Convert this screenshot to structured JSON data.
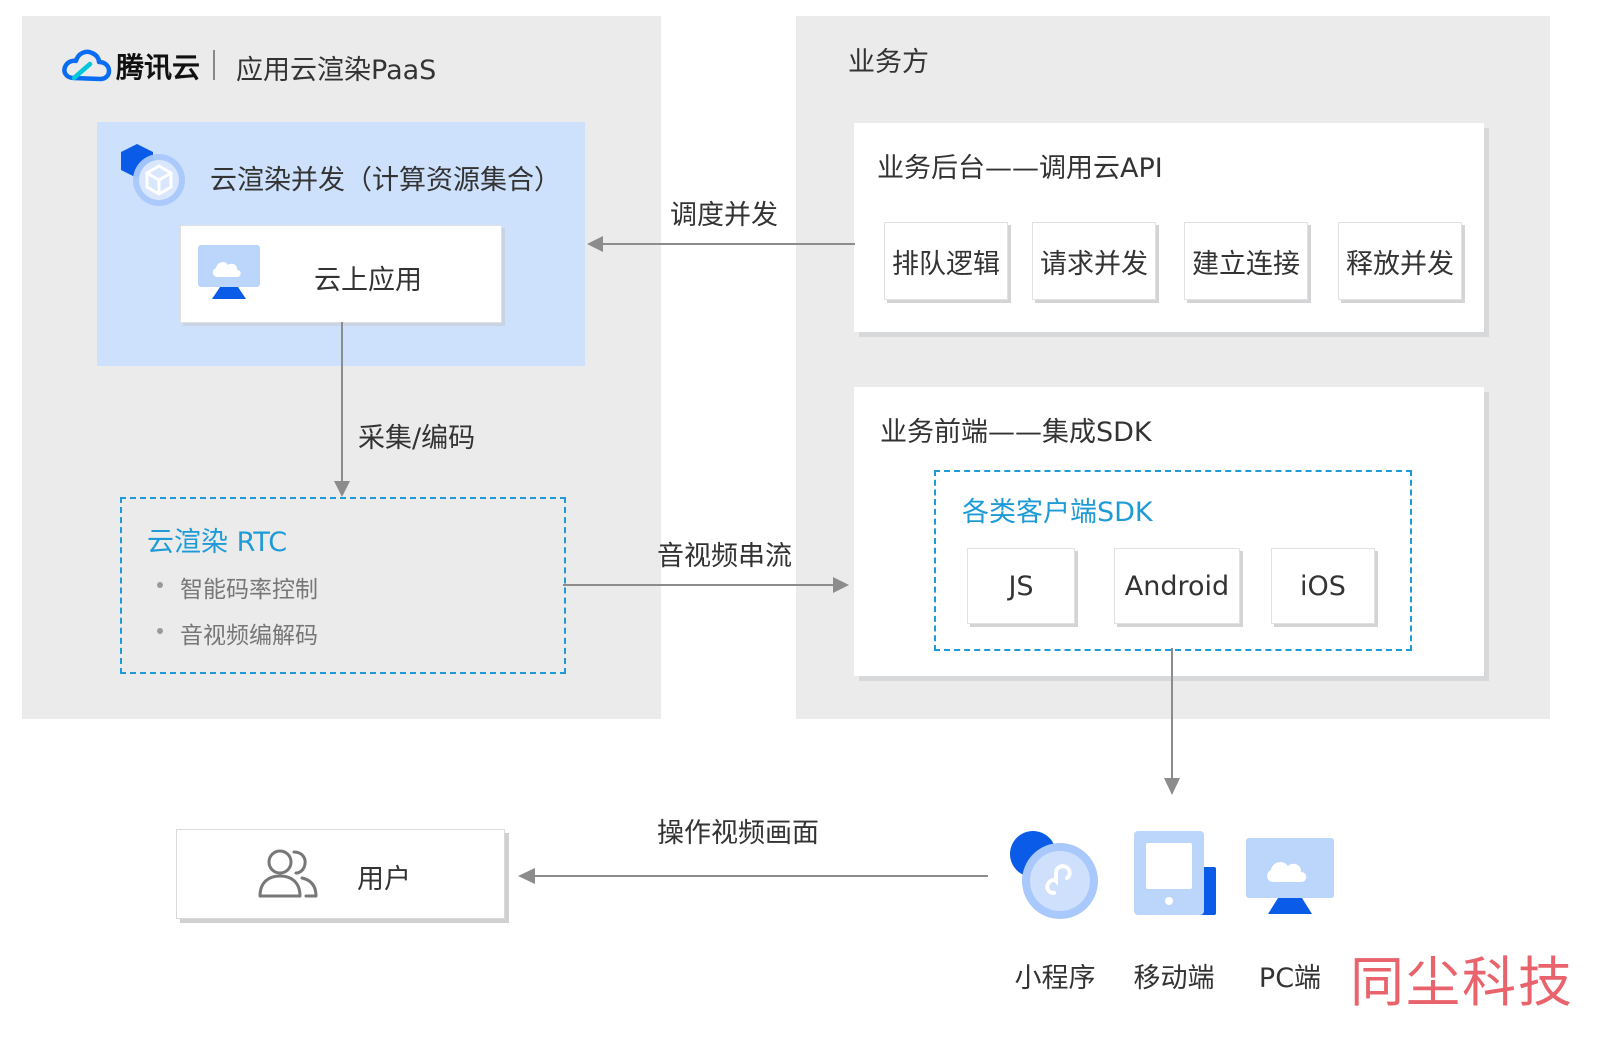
{
  "left_panel": {
    "brand": "腾讯云",
    "product": "应用云渲染PaaS",
    "concurrency_box": {
      "title": "云渲染并发（计算资源集合）",
      "app_label": "云上应用"
    },
    "rtc_box": {
      "title": "云渲染 RTC",
      "bullets": [
        "智能码率控制",
        "音视频编解码"
      ]
    },
    "arrow_capture": "采集/编码"
  },
  "right_panel": {
    "title": "业务方",
    "backend": {
      "title": "业务后台——调用云API",
      "buttons": [
        "排队逻辑",
        "请求并发",
        "建立连接",
        "释放并发"
      ]
    },
    "frontend": {
      "title": "业务前端——集成SDK",
      "sdk_box": {
        "title": "各类客户端SDK",
        "buttons": [
          "JS",
          "Android",
          "iOS"
        ]
      }
    }
  },
  "arrows": {
    "schedule": "调度并发",
    "stream": "音视频串流",
    "operate": "操作视频画面"
  },
  "user_box": {
    "label": "用户"
  },
  "clients": [
    "小程序",
    "移动端",
    "PC端"
  ],
  "watermark": "同尘科技",
  "colors": {
    "panel_bg": "#ebebec",
    "concurrency_bg": "#cde0fc",
    "accent_blue": "#1e9bd6",
    "brand_blue": "#0a6cf3",
    "arrow_gray": "#8c8c8c",
    "watermark_red": "#e8636c"
  }
}
